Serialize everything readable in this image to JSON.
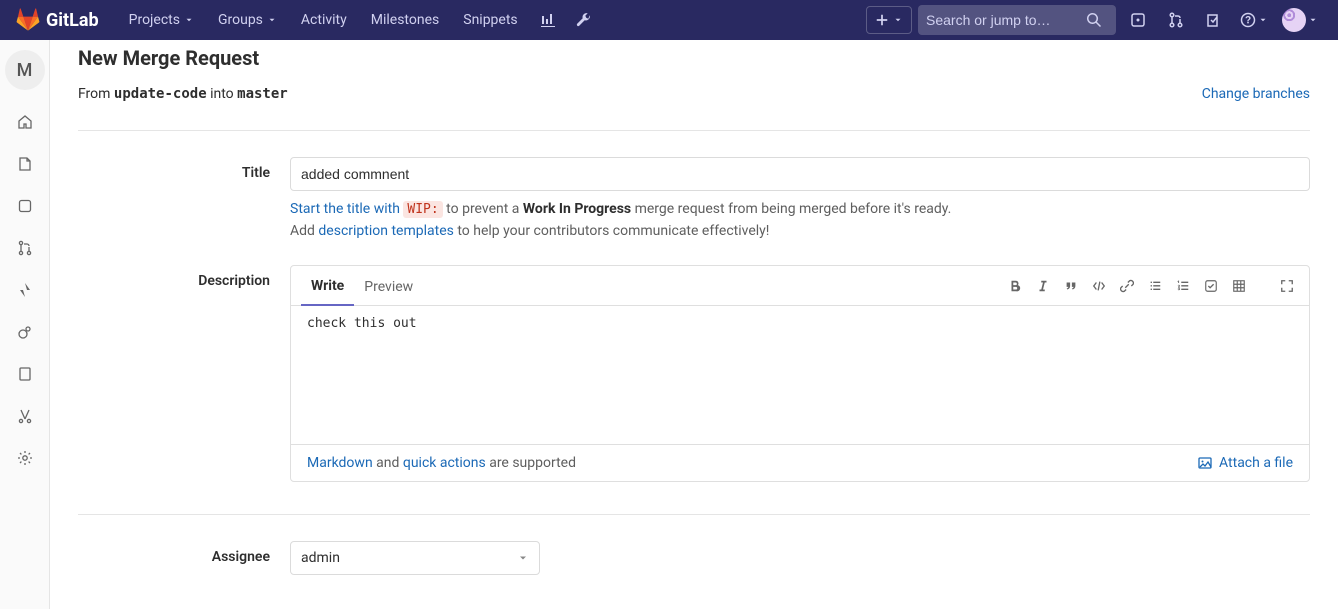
{
  "navbar": {
    "logo_text": "GitLab",
    "projects": "Projects",
    "groups": "Groups",
    "activity": "Activity",
    "milestones": "Milestones",
    "snippets": "Snippets",
    "search_placeholder": "Search or jump to…"
  },
  "sidebar": {
    "project_letter": "M"
  },
  "page": {
    "title": "New Merge Request",
    "from_prefix": "From ",
    "from_branch": "update-code",
    "into_text": " into ",
    "to_branch": "master",
    "change_branches": "Change branches"
  },
  "form": {
    "title_label": "Title",
    "title_value": "added commnent",
    "wip_link": "Start the title with ",
    "wip_code": "WIP:",
    "wip_after": " to prevent a ",
    "wip_strong": "Work In Progress",
    "wip_tail": " merge request from being merged before it's ready.",
    "tmpl_prefix": "Add ",
    "tmpl_link": "description templates",
    "tmpl_tail": " to help your contributors communicate effectively!",
    "desc_label": "Description",
    "write_tab": "Write",
    "preview_tab": "Preview",
    "desc_value": "check this out",
    "footer_md": "Markdown",
    "footer_and": " and ",
    "footer_qa": "quick actions",
    "footer_tail": " are supported",
    "attach": "Attach a file",
    "assignee_label": "Assignee",
    "assignee_value": "admin"
  }
}
